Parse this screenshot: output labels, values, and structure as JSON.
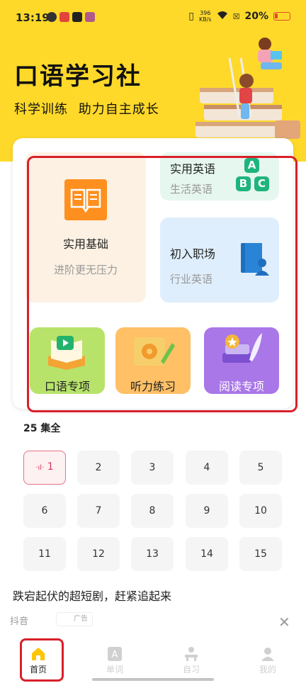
{
  "status_bar": {
    "time": "13:19",
    "net_speed_value": "396",
    "net_speed_unit": "KB/s",
    "battery": "20%"
  },
  "header": {
    "title": "口语学习社",
    "subtitle": "科学训练 助力自主成长"
  },
  "categories": {
    "basic": {
      "title": "实用基础",
      "subtitle": "进阶更无压力"
    },
    "english": {
      "title": "实用英语",
      "subtitle": "生活英语",
      "letters": [
        "A",
        "B",
        "C"
      ]
    },
    "workplace": {
      "title": "初入职场",
      "subtitle": "行业英语"
    },
    "speaking": {
      "label": "口语专项"
    },
    "listening": {
      "label": "听力练习"
    },
    "reading": {
      "label": "阅读专项"
    }
  },
  "episodes": {
    "total_label": "25 集全",
    "playing_indicator": "·ıl·",
    "items": [
      "1",
      "2",
      "3",
      "4",
      "5",
      "6",
      "7",
      "8",
      "9",
      "10",
      "11",
      "12",
      "13",
      "14",
      "15"
    ],
    "active": "1"
  },
  "ad": {
    "title": "跌宕起伏的超短剧，赶紧追起来",
    "source": "抖音",
    "badge": "广告"
  },
  "tabbar": {
    "home": "首页",
    "words": "单词",
    "study": "自习",
    "mine": "我的"
  },
  "colors": {
    "brand_yellow": "#ffd92a",
    "orange_tile": "#ff8f1f",
    "green_tile": "#b7e36b",
    "amber_tile": "#ffc066",
    "purple_tile": "#a977e8",
    "highlight_red": "#d9202a"
  }
}
